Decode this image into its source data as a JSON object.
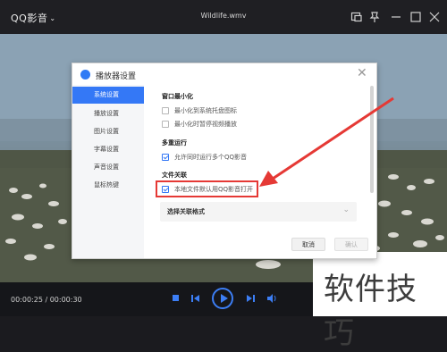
{
  "app": {
    "title": "QQ影音",
    "file_name": "Wildlife.wmv"
  },
  "player": {
    "time": "00:00:25 / 00:00:30",
    "progress": 0.83
  },
  "dialog": {
    "title": "播放器设置",
    "nav": [
      "系统设置",
      "播放设置",
      "图片设置",
      "字幕设置",
      "声音设置",
      "鼠标热键"
    ],
    "active_nav": "系统设置",
    "sections": {
      "window": {
        "title": "窗口最小化",
        "options": [
          "最小化到系统托盘图标",
          "最小化时暂停视频播放"
        ]
      },
      "multi": {
        "title": "多重运行",
        "option": "允许同时运行多个QQ影音"
      },
      "assoc": {
        "title": "文件关联",
        "option": "本地文件默认用QQ影音打开",
        "select_label": "选择关联格式"
      }
    },
    "buttons": {
      "cancel": "取消",
      "ok": "确认"
    }
  },
  "watermark": "软件技巧",
  "colors": {
    "accent": "#3478f6",
    "highlight": "#e53935"
  }
}
